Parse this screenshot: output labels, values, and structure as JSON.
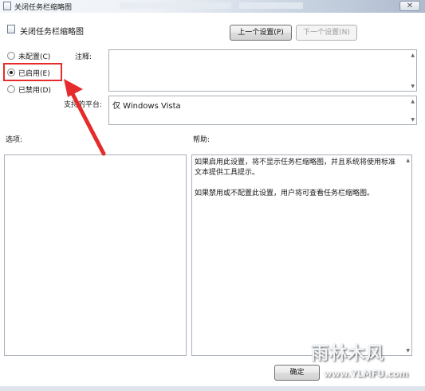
{
  "window": {
    "title": "关闭任务栏缩略图",
    "close_glyph": "✕"
  },
  "header": {
    "title": "关闭任务栏缩略图",
    "prev_button": "上一个设置(P)",
    "next_button": "下一个设置(N)"
  },
  "radios": [
    {
      "label": "未配置(C)",
      "checked": false
    },
    {
      "label": "已启用(E)",
      "checked": true
    },
    {
      "label": "已禁用(D)",
      "checked": false
    }
  ],
  "comment": {
    "label": "注释:",
    "value": ""
  },
  "supported": {
    "label": "支持的平台:",
    "value": "仅 Windows Vista"
  },
  "options": {
    "label": "选项:"
  },
  "help": {
    "label": "帮助:",
    "paragraphs": [
      "如果启用此设置，将不显示任务栏缩略图，并且系统将使用标准文本提供工具提示。",
      "如果禁用或不配置此设置，用户将可查看任务栏缩略图。"
    ]
  },
  "footer": {
    "ok_button": "确定"
  },
  "watermark": {
    "text": "雨林木风",
    "url": "www.YLMFU.com"
  },
  "colors": {
    "highlight_red": "#e52b2b",
    "border": "#a8b0b8"
  }
}
